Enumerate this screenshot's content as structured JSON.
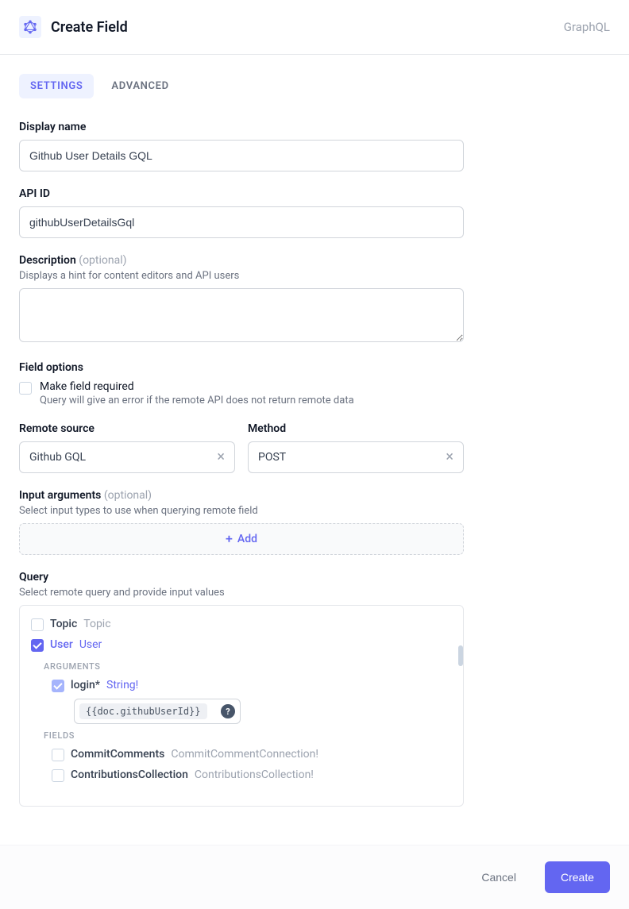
{
  "header": {
    "title": "Create Field",
    "type_label": "GraphQL"
  },
  "tabs": {
    "settings": "SETTINGS",
    "advanced": "ADVANCED"
  },
  "form": {
    "display_name": {
      "label": "Display name",
      "value": "Github User Details GQL"
    },
    "api_id": {
      "label": "API ID",
      "value": "githubUserDetailsGql"
    },
    "description": {
      "label": "Description",
      "optional": "(optional)",
      "hint": "Displays a hint for content editors and API users",
      "value": ""
    },
    "field_options": {
      "label": "Field options",
      "required": {
        "label": "Make field required",
        "hint": "Query will give an error if the remote API does not return remote data"
      }
    },
    "remote_source": {
      "label": "Remote source",
      "value": "Github GQL"
    },
    "method": {
      "label": "Method",
      "value": "POST"
    },
    "input_args": {
      "label": "Input arguments",
      "optional": "(optional)",
      "hint": "Select input types to use when querying remote field",
      "add_label": "Add"
    },
    "query": {
      "label": "Query",
      "hint": "Select remote query and provide input values",
      "sections": {
        "arguments": "ARGUMENTS",
        "fields": "FIELDS"
      },
      "nodes": {
        "topic": {
          "name": "Topic",
          "type": "Topic"
        },
        "user": {
          "name": "User",
          "type": "User"
        },
        "login_arg": {
          "name": "login*",
          "type": "String!",
          "value": "{{doc.githubUserId}}"
        },
        "commit_comments": {
          "name": "CommitComments",
          "type": "CommitCommentConnection!"
        },
        "contributions": {
          "name": "ContributionsCollection",
          "type": "ContributionsCollection!"
        }
      }
    }
  },
  "footer": {
    "cancel": "Cancel",
    "create": "Create"
  }
}
